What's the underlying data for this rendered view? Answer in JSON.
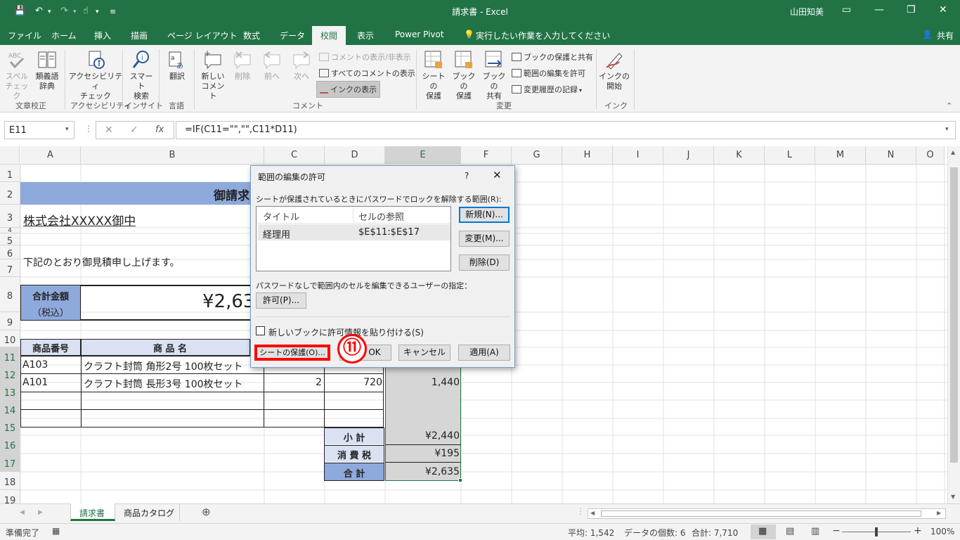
{
  "window": {
    "title": "請求書 - Excel",
    "user": "山田知美"
  },
  "tabs": [
    "ファイル",
    "ホーム",
    "挿入",
    "描画",
    "ページ レイアウト",
    "数式",
    "データ",
    "校閲",
    "表示",
    "Power Pivot"
  ],
  "tell_me": "実行したい作業を入力してください",
  "share": "共有",
  "ribbon": {
    "spell": [
      "スペル",
      "チェック"
    ],
    "thesaurus": [
      "類義語",
      "辞典"
    ],
    "access": [
      "アクセシビリティ",
      "チェック"
    ],
    "smart": [
      "スマート",
      "検索"
    ],
    "translate": "翻訳",
    "newcomment": [
      "新しい",
      "コメント"
    ],
    "delete": "削除",
    "prev": "前へ",
    "next": "次へ",
    "show_hide": "コメントの表示/非表示",
    "show_all": "すべてのコメントの表示",
    "show_ink": "インクの表示",
    "protect_sheet": [
      "シートの",
      "保護"
    ],
    "protect_book": [
      "ブックの",
      "保護"
    ],
    "share_book": [
      "ブックの",
      "共有"
    ],
    "protect_share": "ブックの保護と共有",
    "allow_edit": "範囲の編集を許可",
    "track": "変更履歴の記録",
    "ink_start": [
      "インクの",
      "開始"
    ],
    "groups": [
      "文章校正",
      "アクセシビリティ",
      "インサイト",
      "言語",
      "コメント",
      "変更",
      "インク"
    ]
  },
  "namebox": "E11",
  "formula": "=IF(C11=\"\",\"\",C11*D11)",
  "columns": [
    "A",
    "B",
    "C",
    "D",
    "E",
    "F",
    "G",
    "H",
    "I",
    "J",
    "K",
    "L",
    "M",
    "N",
    "O"
  ],
  "rows": [
    "1",
    "2",
    "3",
    "4",
    "5",
    "6",
    "7",
    "8",
    "9",
    "10",
    "11",
    "12",
    "13",
    "14",
    "15",
    "16",
    "17",
    "18",
    "19"
  ],
  "sheet": {
    "title": "御請求",
    "company": "株式会社XXXXX御中",
    "note": "下記のとおり御見積申し上げます。",
    "total_label": "合計金額",
    "total_sub": "（税込）",
    "total_value": "¥2,63",
    "header_code": "商品番号",
    "header_name": "商 品 名",
    "r11": {
      "code": "A103",
      "name": "クラフト封筒 角形2号 100枚セット"
    },
    "r12": {
      "code": "A101",
      "name": "クラフト封筒 長形3号 100枚セット",
      "qty": "2",
      "price": "720",
      "amount": "1,440"
    },
    "subtotal_label": "小 計",
    "subtotal": "¥2,440",
    "tax_label": "消 費 税",
    "tax": "¥195",
    "grand_label": "合 計",
    "grand": "¥2,635"
  },
  "dialog": {
    "title": "範囲の編集の許可",
    "help": "?",
    "ranges_label": "シートが保護されているときにパスワードでロックを解除する範囲(R):",
    "col_title": "タイトル",
    "col_ref": "セルの参照",
    "row_title": "経理用",
    "row_ref": "$E$11:$E$17",
    "btn_new": "新規(N)...",
    "btn_modify": "変更(M)...",
    "btn_delete": "削除(D)",
    "users_label": "パスワードなしで範囲内のセルを編集できるユーザーの指定：",
    "btn_perm": "許可(P)...",
    "paste_label": "新しいブックに許可情報を貼り付ける(S)",
    "btn_protect": "シートの保護(O)...",
    "btn_ok": "OK",
    "btn_cancel": "キャンセル",
    "btn_apply": "適用(A)"
  },
  "callout": "⑪",
  "sheet_tabs": [
    "請求書",
    "商品カタログ"
  ],
  "status": {
    "ready": "準備完了",
    "avg": "平均: 1,542",
    "count": "データの個数: 6",
    "sum": "合計: 7,710",
    "zoom": "100%"
  },
  "colors": {
    "excel_green": "#217346",
    "header_blue": "#8ea9db",
    "light_blue": "#d9e1f2",
    "highlight_red": "#ff0000"
  }
}
